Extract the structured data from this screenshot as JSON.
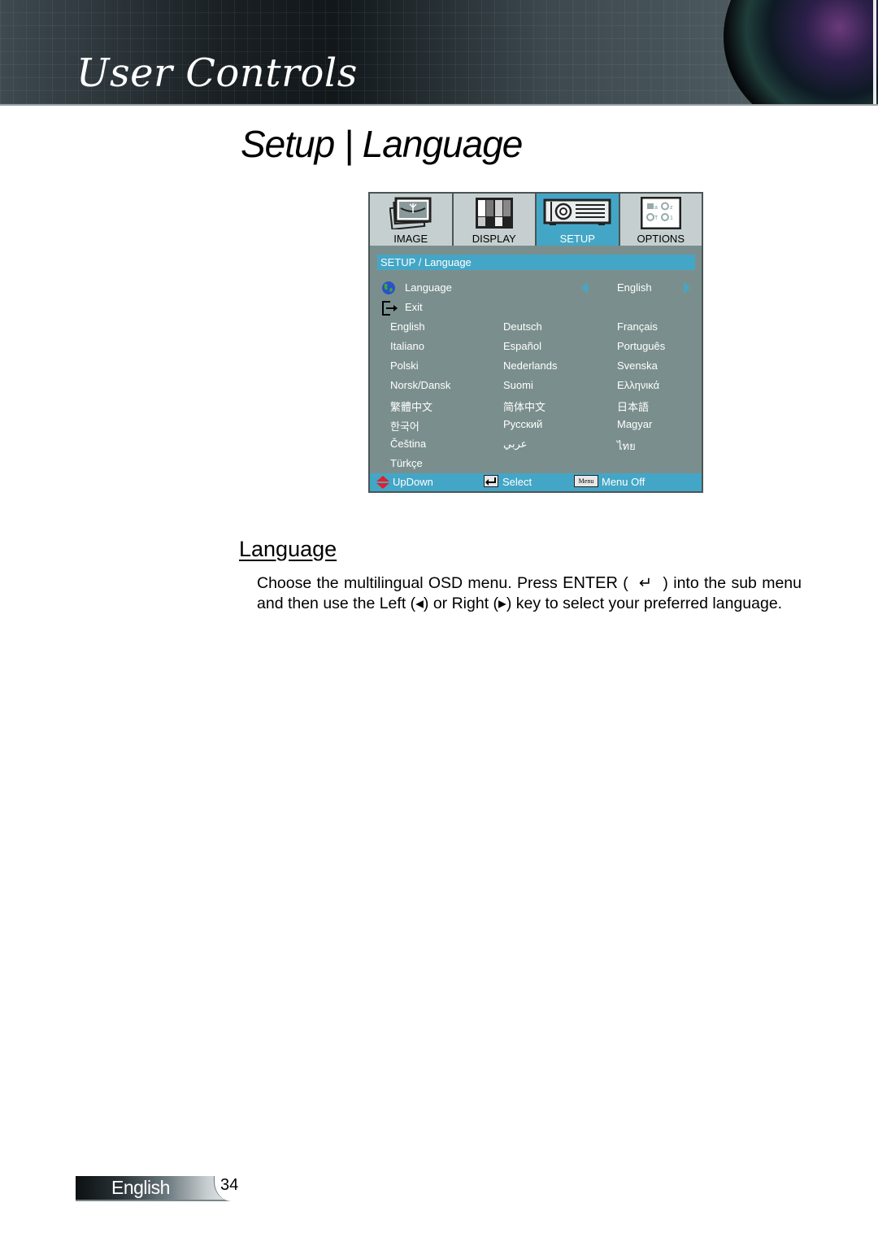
{
  "header": {
    "section_title": "User Controls"
  },
  "page": {
    "title": "Setup | Language"
  },
  "osd": {
    "tabs": [
      {
        "label": "IMAGE",
        "icon": "image-icon",
        "active": false
      },
      {
        "label": "DISPLAY",
        "icon": "display-icon",
        "active": false
      },
      {
        "label": "SETUP",
        "icon": "projector-icon",
        "active": true
      },
      {
        "label": "OPTIONS",
        "icon": "options-icon",
        "active": false
      }
    ],
    "breadcrumb": "SETUP / Language",
    "language_row": {
      "label": "Language",
      "value": "English",
      "icon": "globe-icon"
    },
    "exit_row": {
      "label": "Exit",
      "icon": "exit-icon"
    },
    "languages": [
      [
        "English",
        "Deutsch",
        "Français"
      ],
      [
        "Italiano",
        "Español",
        "Português"
      ],
      [
        "Polski",
        "Nederlands",
        "Svenska"
      ],
      [
        "Norsk/Dansk",
        "Suomi",
        "Ελληνικά"
      ],
      [
        "繁體中文",
        "简体中文",
        "日本語"
      ],
      [
        "한국어",
        "Русский",
        "Magyar"
      ],
      [
        "Čeština",
        "عربي",
        "ไทย"
      ],
      [
        "Türkçe",
        "",
        ""
      ]
    ],
    "footer": {
      "updown": "UpDown",
      "select": "Select",
      "menu_key": "Menu",
      "menu_off": "Menu Off"
    },
    "colors": {
      "accent": "#44a6c6",
      "panel": "#7a8f8d",
      "tab_bg": "#c6cfcf"
    }
  },
  "section": {
    "heading": "Language",
    "text_1": "Choose the multilingual OSD menu. Press ",
    "enter_label": "ENTER",
    "text_2": " ( ",
    "enter_glyph": "↵",
    "text_3": " ) into the sub menu and then use the Left (◂) or Right (▸) key to select your preferred language."
  },
  "footer": {
    "language": "English",
    "page_number": "34"
  }
}
